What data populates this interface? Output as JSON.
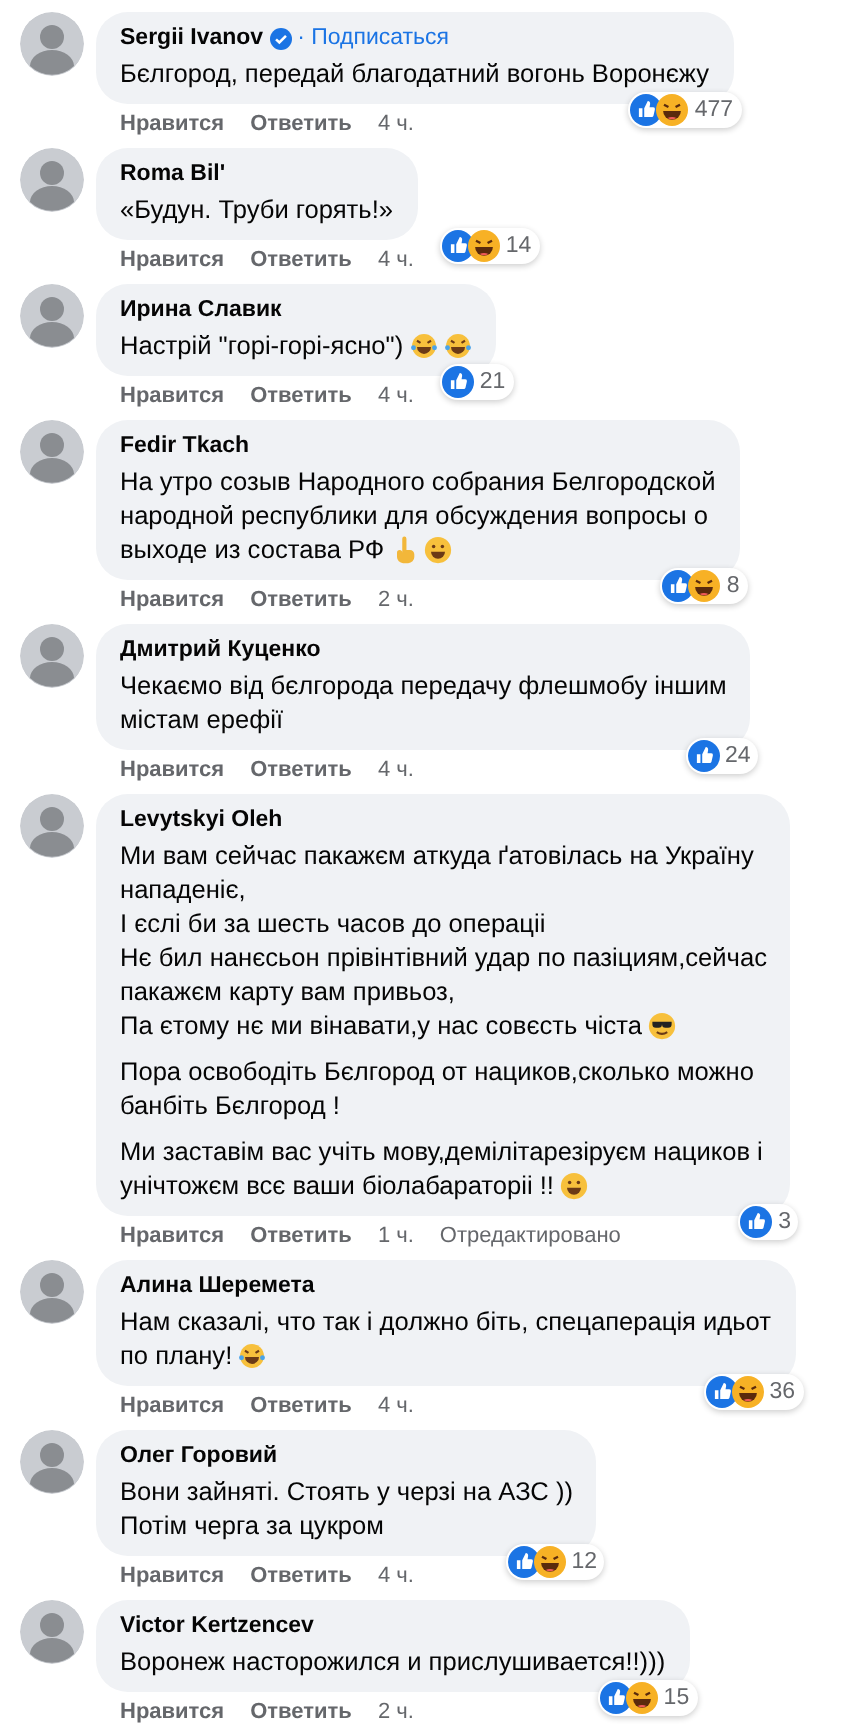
{
  "comments": [
    {
      "author": "Sergii Ivanov",
      "verified": true,
      "follow": "· Подписаться",
      "paragraphs": [
        [
          [
            {
              "kind": "text",
              "text": "Бєлгород, передай благодатний вогонь Воронєжу"
            }
          ]
        ]
      ],
      "reactions": [
        {
          "kind": "like"
        },
        {
          "kind": "haha"
        }
      ],
      "count": "477",
      "actions": [
        "Нравится",
        "Ответить"
      ],
      "time": "4 ч."
    },
    {
      "author": "Roma Bil'",
      "paragraphs": [
        [
          [
            {
              "kind": "text",
              "text": "«Будун. Труби горять!»"
            }
          ]
        ]
      ],
      "reactions": [
        {
          "kind": "like"
        },
        {
          "kind": "haha"
        }
      ],
      "count": "14",
      "actions": [
        "Нравится",
        "Ответить"
      ],
      "time": "4 ч."
    },
    {
      "author": "Ирина Славик",
      "paragraphs": [
        [
          [
            {
              "kind": "text",
              "text": "Настрій \"горі-горі-ясно\")"
            },
            {
              "kind": "tears"
            },
            {
              "kind": "tears"
            }
          ]
        ]
      ],
      "reactions": [
        {
          "kind": "like"
        }
      ],
      "count": "21",
      "actions": [
        "Нравится",
        "Ответить"
      ],
      "time": "4 ч."
    },
    {
      "author": "Fedir Tkach",
      "paragraphs": [
        [
          [
            {
              "kind": "text",
              "text": "На утро созыв Народного собрания Белгородской"
            }
          ],
          [
            {
              "kind": "text",
              "text": "народной республики для обсуждения вопросы о"
            }
          ],
          [
            {
              "kind": "text",
              "text": "выходе из состава РФ"
            },
            {
              "kind": "point"
            },
            {
              "kind": "grin"
            }
          ]
        ]
      ],
      "reactions": [
        {
          "kind": "like"
        },
        {
          "kind": "haha"
        }
      ],
      "count": "8",
      "actions": [
        "Нравится",
        "Ответить"
      ],
      "time": "2 ч."
    },
    {
      "author": "Дмитрий Куценко",
      "paragraphs": [
        [
          [
            {
              "kind": "text",
              "text": "Чекаємо від бєлгорода передачу флешмобу іншим"
            }
          ],
          [
            {
              "kind": "text",
              "text": "містам ерефії"
            }
          ]
        ]
      ],
      "reactions": [
        {
          "kind": "like"
        }
      ],
      "count": "24",
      "actions": [
        "Нравится",
        "Ответить"
      ],
      "time": "4 ч."
    },
    {
      "author": "Levytskyi Oleh",
      "paragraphs": [
        [
          [
            {
              "kind": "text",
              "text": "Ми вам сейчас пакажєм аткуда ґатовілась на Україну"
            }
          ],
          [
            {
              "kind": "text",
              "text": "нападеніє,"
            }
          ],
          [
            {
              "kind": "text",
              "text": "І єслі би за шесть часов до операціі"
            }
          ],
          [
            {
              "kind": "text",
              "text": "Нє бил нанєсьон прівінтівний удар по пазіциям,сейчас"
            }
          ],
          [
            {
              "kind": "text",
              "text": "пакажєм карту вам привьоз,"
            }
          ],
          [
            {
              "kind": "text",
              "text": "Па єтому нє ми вінавати,у нас совєсть чіста"
            },
            {
              "kind": "cool"
            }
          ]
        ],
        [
          [
            {
              "kind": "text",
              "text": "Пора освободіть Бєлгород от нациков,сколько можно"
            }
          ],
          [
            {
              "kind": "text",
              "text": "банбіть Бєлгород !"
            }
          ]
        ],
        [
          [
            {
              "kind": "text",
              "text": "Ми заставім вас учіть мову,демілітарезіруєм нациков і"
            }
          ],
          [
            {
              "kind": "text",
              "text": "унічтожєм всє ваши біолабараторіі !!"
            },
            {
              "kind": "grin"
            }
          ]
        ]
      ],
      "reactions": [
        {
          "kind": "like"
        }
      ],
      "count": "3",
      "actions": [
        "Нравится",
        "Ответить"
      ],
      "time": "1 ч.",
      "edited": "Отредактировано"
    },
    {
      "author": "Алина Шеремета",
      "paragraphs": [
        [
          [
            {
              "kind": "text",
              "text": "Нам сказалі, что так і должно біть, спецаперація идьот"
            }
          ],
          [
            {
              "kind": "text",
              "text": "по плану!"
            },
            {
              "kind": "tears"
            }
          ]
        ]
      ],
      "reactions": [
        {
          "kind": "like"
        },
        {
          "kind": "haha"
        }
      ],
      "count": "36",
      "actions": [
        "Нравится",
        "Ответить"
      ],
      "time": "4 ч."
    },
    {
      "author": "Олег Горовий",
      "paragraphs": [
        [
          [
            {
              "kind": "text",
              "text": "Вони зайняті. Стоять у черзі на АЗС ))"
            }
          ],
          [
            {
              "kind": "text",
              "text": "Потім черга за цукром"
            }
          ]
        ]
      ],
      "reactions": [
        {
          "kind": "like"
        },
        {
          "kind": "haha"
        }
      ],
      "count": "12",
      "actions": [
        "Нравится",
        "Ответить"
      ],
      "time": "4 ч."
    },
    {
      "author": "Victor Kertzencev",
      "paragraphs": [
        [
          [
            {
              "kind": "text",
              "text": "Воронеж насторожился и прислушивается!!)))"
            }
          ]
        ]
      ],
      "reactions": [
        {
          "kind": "like"
        },
        {
          "kind": "haha"
        }
      ],
      "count": "15",
      "actions": [
        "Нравится",
        "Ответить"
      ],
      "time": "2 ч."
    }
  ]
}
